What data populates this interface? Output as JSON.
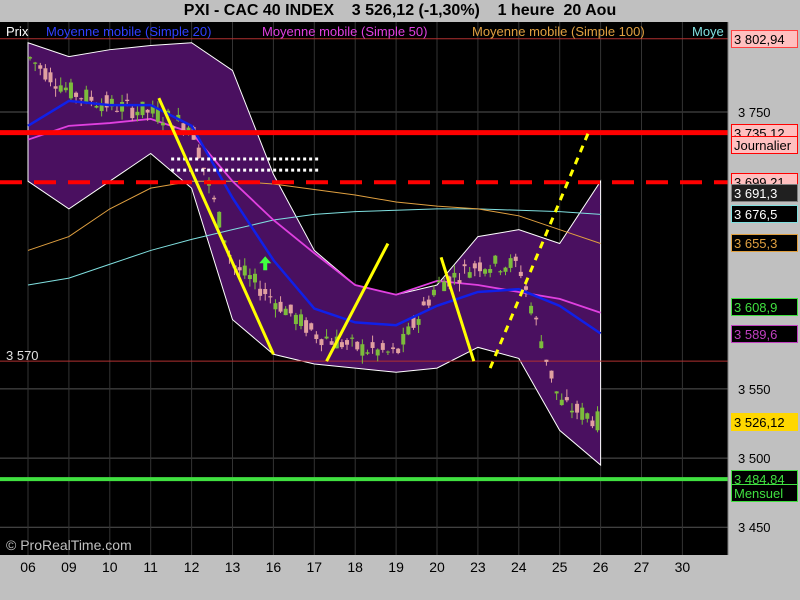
{
  "header": {
    "title": "PXI - CAC 40 INDEX    3 526,12 (-1,30%)    1 heure  20 Aou"
  },
  "legend": {
    "price": "Prix",
    "ma20": "Moyenne mobile (Simple 20)",
    "ma50": "Moyenne mobile (Simple 50)",
    "ma100": "Moyenne mobile (Simple 100)",
    "ma200": "Moye"
  },
  "watermark": "© ProRealTime.com",
  "level_label": "3 570",
  "colors": {
    "background": "#000000",
    "frame": "#c0c0c0",
    "bollinger_fill": "#4a1060",
    "candle_up": "#7cbc3c",
    "candle_down": "#e0a0a0",
    "ma20": "#1020e8",
    "ma50": "#e040e0",
    "ma100": "#e0a040",
    "ma200": "#80e0e0",
    "support_resistance": "#ff0000",
    "monthly_support": "#40e040",
    "trend_lines": "#ffff00"
  },
  "chart_data": {
    "type": "line",
    "title": "PXI - CAC 40 INDEX",
    "timeframe": "1 heure",
    "last_price": 3526.12,
    "change_pct": -1.3,
    "x_ticks": [
      "06",
      "09",
      "10",
      "11",
      "12",
      "13",
      "16",
      "17",
      "18",
      "19",
      "20",
      "23",
      "24",
      "25",
      "26",
      "27",
      "30"
    ],
    "ylim": [
      3430,
      3815
    ],
    "y_ticks": [
      3450,
      3500,
      3550,
      3750
    ],
    "y_tick_labels": [
      "3 450",
      "3 500",
      "3 550",
      "3 750"
    ],
    "scale_labels": [
      {
        "text": "3 802,94",
        "value": 3802.94,
        "style": "top"
      },
      {
        "text": "3 735,12",
        "value": 3735.12,
        "style": "red"
      },
      {
        "text": "Journalier",
        "value": 3726,
        "style": "red-sub"
      },
      {
        "text": "3 699,21",
        "value": 3699.21,
        "style": "red"
      },
      {
        "text": "3 691,3",
        "value": 3691.3,
        "style": "dark"
      },
      {
        "text": "3 676,5",
        "value": 3676.5,
        "style": "cyan"
      },
      {
        "text": "3 655,3",
        "value": 3655.3,
        "style": "orange"
      },
      {
        "text": "3 608,9",
        "value": 3608.9,
        "style": "green"
      },
      {
        "text": "3 589,6",
        "value": 3589.6,
        "style": "purple"
      },
      {
        "text": "3 526,12",
        "value": 3526.12,
        "style": "yellow"
      },
      {
        "text": "3 484,84",
        "value": 3484.84,
        "style": "green"
      },
      {
        "text": "Mensuel",
        "value": 3475,
        "style": "green-sub"
      }
    ],
    "horizontal_lines": [
      {
        "name": "Journalier",
        "value": 3735.12,
        "style": "solid-red"
      },
      {
        "name": "",
        "value": 3699.21,
        "style": "dashed-red"
      },
      {
        "name": "Mensuel",
        "value": 3484.84,
        "style": "solid-green"
      },
      {
        "name": "",
        "value": 3570,
        "style": "thin-red"
      },
      {
        "name": "",
        "value": 3802.94,
        "style": "thin-red"
      }
    ],
    "bollinger_upper": [
      [
        0,
        3800
      ],
      [
        1,
        3790
      ],
      [
        2,
        3795
      ],
      [
        3,
        3798
      ],
      [
        4,
        3800
      ],
      [
        5,
        3780
      ],
      [
        6,
        3705
      ],
      [
        7,
        3650
      ],
      [
        8,
        3625
      ],
      [
        9,
        3618
      ],
      [
        10,
        3625
      ],
      [
        11,
        3660
      ],
      [
        12,
        3665
      ],
      [
        13,
        3655
      ],
      [
        14,
        3700
      ]
    ],
    "bollinger_lower": [
      [
        0,
        3700
      ],
      [
        1,
        3680
      ],
      [
        2,
        3700
      ],
      [
        3,
        3720
      ],
      [
        4,
        3695
      ],
      [
        5,
        3600
      ],
      [
        6,
        3575
      ],
      [
        7,
        3568
      ],
      [
        8,
        3565
      ],
      [
        9,
        3562
      ],
      [
        10,
        3565
      ],
      [
        11,
        3580
      ],
      [
        12,
        3572
      ],
      [
        13,
        3520
      ],
      [
        14,
        3495
      ]
    ],
    "ma20": [
      [
        0,
        3740
      ],
      [
        1,
        3758
      ],
      [
        2,
        3755
      ],
      [
        3,
        3755
      ],
      [
        4,
        3740
      ],
      [
        5,
        3688
      ],
      [
        6,
        3643
      ],
      [
        7,
        3608
      ],
      [
        8,
        3598
      ],
      [
        9,
        3596
      ],
      [
        10,
        3610
      ],
      [
        11,
        3620
      ],
      [
        12,
        3622
      ],
      [
        13,
        3610
      ],
      [
        14,
        3590
      ]
    ],
    "ma50": [
      [
        0,
        3730
      ],
      [
        1,
        3740
      ],
      [
        2,
        3742
      ],
      [
        3,
        3745
      ],
      [
        4,
        3735
      ],
      [
        5,
        3700
      ],
      [
        6,
        3672
      ],
      [
        7,
        3648
      ],
      [
        8,
        3625
      ],
      [
        9,
        3618
      ],
      [
        10,
        3628
      ],
      [
        11,
        3625
      ],
      [
        12,
        3620
      ],
      [
        13,
        3615
      ],
      [
        14,
        3605
      ]
    ],
    "ma100": [
      [
        0,
        3650
      ],
      [
        1,
        3660
      ],
      [
        2,
        3680
      ],
      [
        3,
        3695
      ],
      [
        4,
        3700
      ],
      [
        5,
        3700
      ],
      [
        6,
        3698
      ],
      [
        7,
        3694
      ],
      [
        8,
        3690
      ],
      [
        9,
        3685
      ],
      [
        10,
        3682
      ],
      [
        11,
        3680
      ],
      [
        12,
        3675
      ],
      [
        13,
        3665
      ],
      [
        14,
        3655
      ]
    ],
    "ma200": [
      [
        0,
        3625
      ],
      [
        1,
        3630
      ],
      [
        2,
        3640
      ],
      [
        3,
        3650
      ],
      [
        4,
        3658
      ],
      [
        5,
        3665
      ],
      [
        6,
        3672
      ],
      [
        7,
        3676
      ],
      [
        8,
        3678
      ],
      [
        9,
        3679
      ],
      [
        10,
        3680
      ],
      [
        11,
        3680
      ],
      [
        12,
        3679
      ],
      [
        13,
        3678
      ],
      [
        14,
        3676
      ]
    ],
    "price_path": [
      [
        0,
        3790
      ],
      [
        1,
        3765
      ],
      [
        2,
        3755
      ],
      [
        3,
        3750
      ],
      [
        4,
        3740
      ],
      [
        5,
        3640
      ],
      [
        6,
        3615
      ],
      [
        7,
        3590
      ],
      [
        8,
        3580
      ],
      [
        9,
        3575
      ],
      [
        10,
        3625
      ],
      [
        11,
        3640
      ],
      [
        12,
        3640
      ],
      [
        13,
        3540
      ],
      [
        14,
        3526
      ]
    ],
    "trend_lines": [
      {
        "from": [
          3.2,
          3760
        ],
        "to": [
          6.0,
          3575
        ],
        "style": "solid"
      },
      {
        "from": [
          7.3,
          3570
        ],
        "to": [
          8.8,
          3655
        ],
        "style": "solid"
      },
      {
        "from": [
          10.1,
          3645
        ],
        "to": [
          10.9,
          3570
        ],
        "style": "solid"
      },
      {
        "from": [
          11.3,
          3565
        ],
        "to": [
          13.7,
          3735
        ],
        "style": "dotted"
      }
    ],
    "white_dotted_lines": [
      {
        "from": [
          3.5,
          3716
        ],
        "to": [
          7.1,
          3716
        ]
      },
      {
        "from": [
          3.5,
          3708
        ],
        "to": [
          7.1,
          3708
        ]
      }
    ],
    "signal_arrow": {
      "x": 5.8,
      "y": 3640,
      "direction": "up"
    }
  }
}
